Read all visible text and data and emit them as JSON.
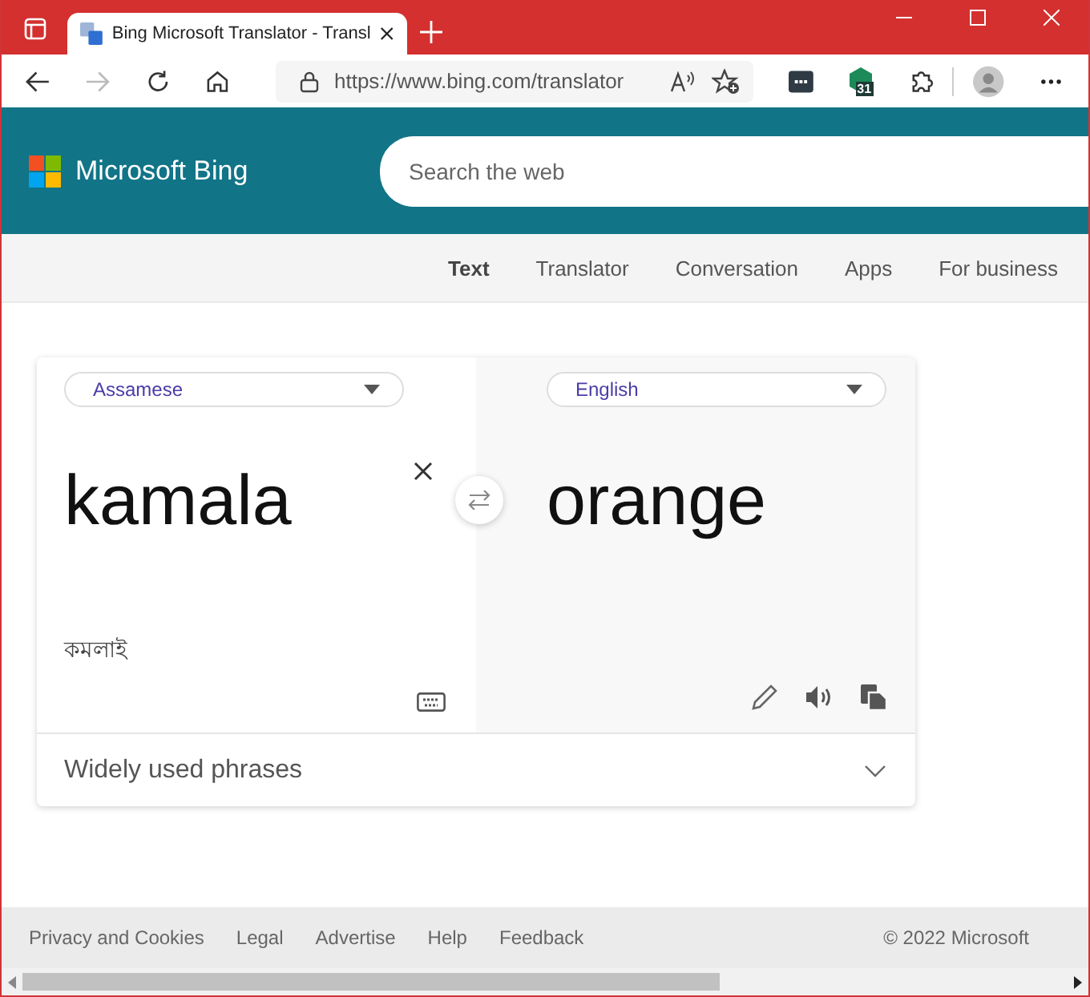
{
  "browser": {
    "tab_title": "Bing Microsoft Translator - Transl",
    "address": "https://www.bing.com/translator",
    "extension_badge": "31"
  },
  "header": {
    "brand": "Microsoft Bing",
    "search": {
      "placeholder": "Search the web"
    }
  },
  "nav": [
    {
      "label": "Text",
      "selected": true
    },
    {
      "label": "Translator",
      "selected": false
    },
    {
      "label": "Conversation",
      "selected": false
    },
    {
      "label": "Apps",
      "selected": false
    },
    {
      "label": "For business",
      "selected": false
    }
  ],
  "translator": {
    "source_language": "Assamese",
    "target_language": "English",
    "input": "kamala",
    "transliteration": "কমলাই",
    "output": "orange"
  },
  "phrases": {
    "label": "Widely used phrases",
    "expanded": false
  },
  "footer": {
    "links": [
      "Privacy and Cookies",
      "Legal",
      "Advertise",
      "Help",
      "Feedback"
    ],
    "copyright": "© 2022 Microsoft"
  }
}
